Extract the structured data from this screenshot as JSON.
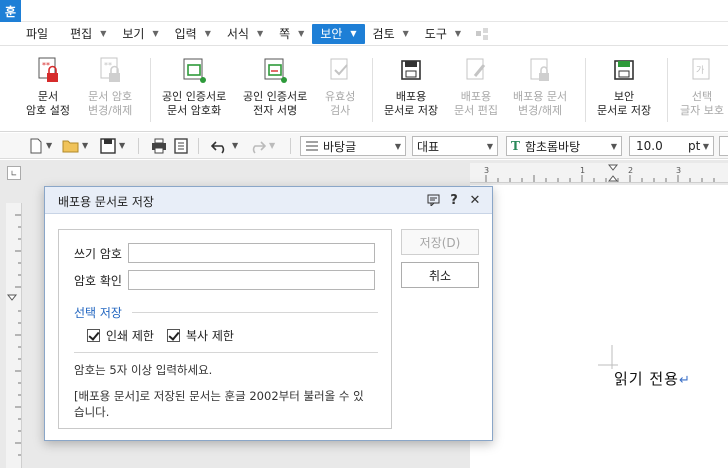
{
  "app": {
    "logo": "훈"
  },
  "menu": {
    "items": [
      {
        "label": "파일",
        "caret": false,
        "active": false
      },
      {
        "label": "편집",
        "caret": true,
        "active": false
      },
      {
        "label": "보기",
        "caret": true,
        "active": false
      },
      {
        "label": "입력",
        "caret": true,
        "active": false
      },
      {
        "label": "서식",
        "caret": true,
        "active": false
      },
      {
        "label": "쪽",
        "caret": true,
        "active": false
      },
      {
        "label": "보안",
        "caret": true,
        "active": true
      },
      {
        "label": "검토",
        "caret": true,
        "active": false
      },
      {
        "label": "도구",
        "caret": true,
        "active": false
      }
    ]
  },
  "ribbon": {
    "doc_password": {
      "line1": "문서",
      "line2": "암호 설정"
    },
    "change_password": {
      "line1": "문서 암호",
      "line2": "변경/해제"
    },
    "cert_encrypt": {
      "line1": "공인 인증서로",
      "line2": "문서 암호화"
    },
    "cert_sign": {
      "line1": "공인 인증서로",
      "line2": "전자 서명"
    },
    "validity": {
      "line1": "유효성",
      "line2": "검사"
    },
    "dist_save": {
      "line1": "배포용",
      "line2": "문서로 저장"
    },
    "dist_edit": {
      "line1": "배포용",
      "line2": "문서 편집"
    },
    "dist_change": {
      "line1": "배포용 문서",
      "line2": "변경/해제"
    },
    "secure_save": {
      "line1": "보안",
      "line2": "문서로 저장"
    },
    "select_protect": {
      "line1": "선택",
      "line2": "글자 보호"
    }
  },
  "format_bar": {
    "style": "바탕글",
    "lang": "대표",
    "font": "함초롬바탕",
    "size": "10.0",
    "unit": "pt"
  },
  "document": {
    "text": "읽기 전용",
    "return_mark": "↵"
  },
  "dialog": {
    "title": "배포용 문서로 저장",
    "write_password_label": "쓰기 암호",
    "write_password_value": "",
    "confirm_password_label": "암호 확인",
    "confirm_password_value": "",
    "section_title": "선택 저장",
    "print_restrict": "인쇄 제한",
    "copy_restrict": "복사 제한",
    "note1": "암호는 5자 이상 입력하세요.",
    "note2_line1": "[배포용 문서]로 저장된 문서는 훈글 2002부터 불러올 수 있",
    "note2_line2": "습니다.",
    "save_button": "저장(D)",
    "cancel_button": "취소",
    "help_label": "?",
    "close_label": "✕"
  },
  "colors": {
    "accent": "#1e7fd6",
    "lock_red": "#d62b2b",
    "green": "#2e9a3a"
  }
}
